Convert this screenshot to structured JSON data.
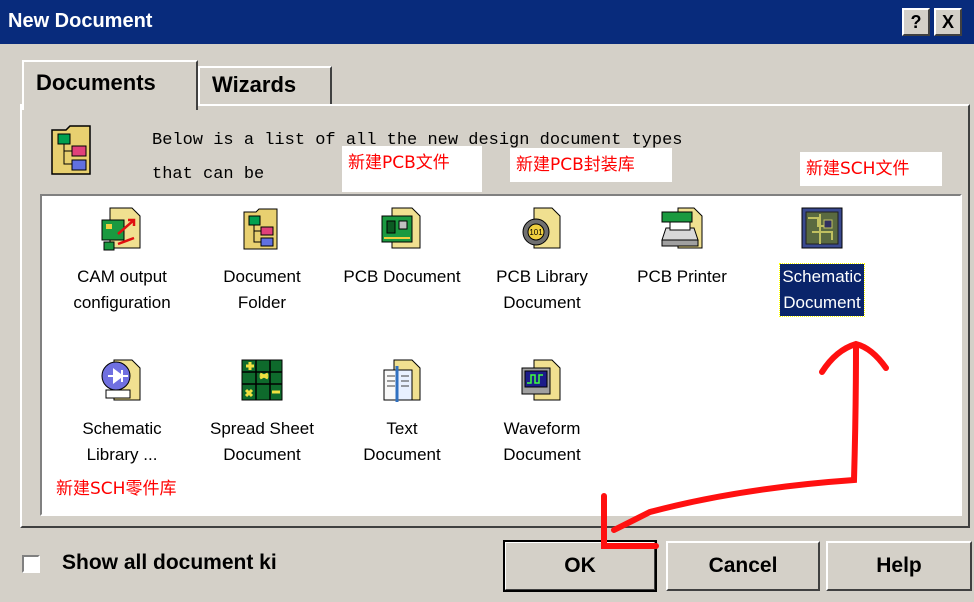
{
  "window": {
    "title": "New Document",
    "help_button": "?",
    "close_button": "X"
  },
  "tabs": [
    {
      "label": "Documents",
      "active": true
    },
    {
      "label": "Wizards",
      "active": false
    }
  ],
  "description": {
    "line1": "Below is a list of all the new design document types",
    "line2": "that can be"
  },
  "documents": [
    {
      "icon": "cam-output-icon",
      "label_line1": "CAM output",
      "label_line2": "configuration",
      "selected": false
    },
    {
      "icon": "document-folder-icon",
      "label_line1": "Document",
      "label_line2": "Folder",
      "selected": false
    },
    {
      "icon": "pcb-document-icon",
      "label_line1": "PCB Document",
      "label_line2": "",
      "selected": false
    },
    {
      "icon": "pcb-library-icon",
      "label_line1": "PCB Library",
      "label_line2": "Document",
      "selected": false
    },
    {
      "icon": "pcb-printer-icon",
      "label_line1": "PCB Printer",
      "label_line2": "",
      "selected": false
    },
    {
      "icon": "schematic-document-icon",
      "label_line1": "Schematic",
      "label_line2": "Document",
      "selected": true
    },
    {
      "icon": "schematic-library-icon",
      "label_line1": "Schematic",
      "label_line2": "Library ...",
      "selected": false
    },
    {
      "icon": "spread-sheet-icon",
      "label_line1": "Spread Sheet",
      "label_line2": "Document",
      "selected": false
    },
    {
      "icon": "text-document-icon",
      "label_line1": "Text",
      "label_line2": "Document",
      "selected": false
    },
    {
      "icon": "waveform-document-icon",
      "label_line1": "Waveform",
      "label_line2": "Document",
      "selected": false
    }
  ],
  "annotations": {
    "new_pcb_file": "新建PCB文件",
    "new_pcb_library": "新建PCB封装库",
    "new_sch_file": "新建SCH文件",
    "new_sch_library": "新建SCH零件库"
  },
  "footer": {
    "show_all_label": "Show all document ki",
    "show_all_checked": false,
    "ok": "OK",
    "cancel": "Cancel",
    "help": "Help"
  },
  "colors": {
    "titlebar": "#082b7c",
    "dialog_face": "#d4d0c8",
    "selection": "#0a246a",
    "annotation": "#ff0000"
  }
}
